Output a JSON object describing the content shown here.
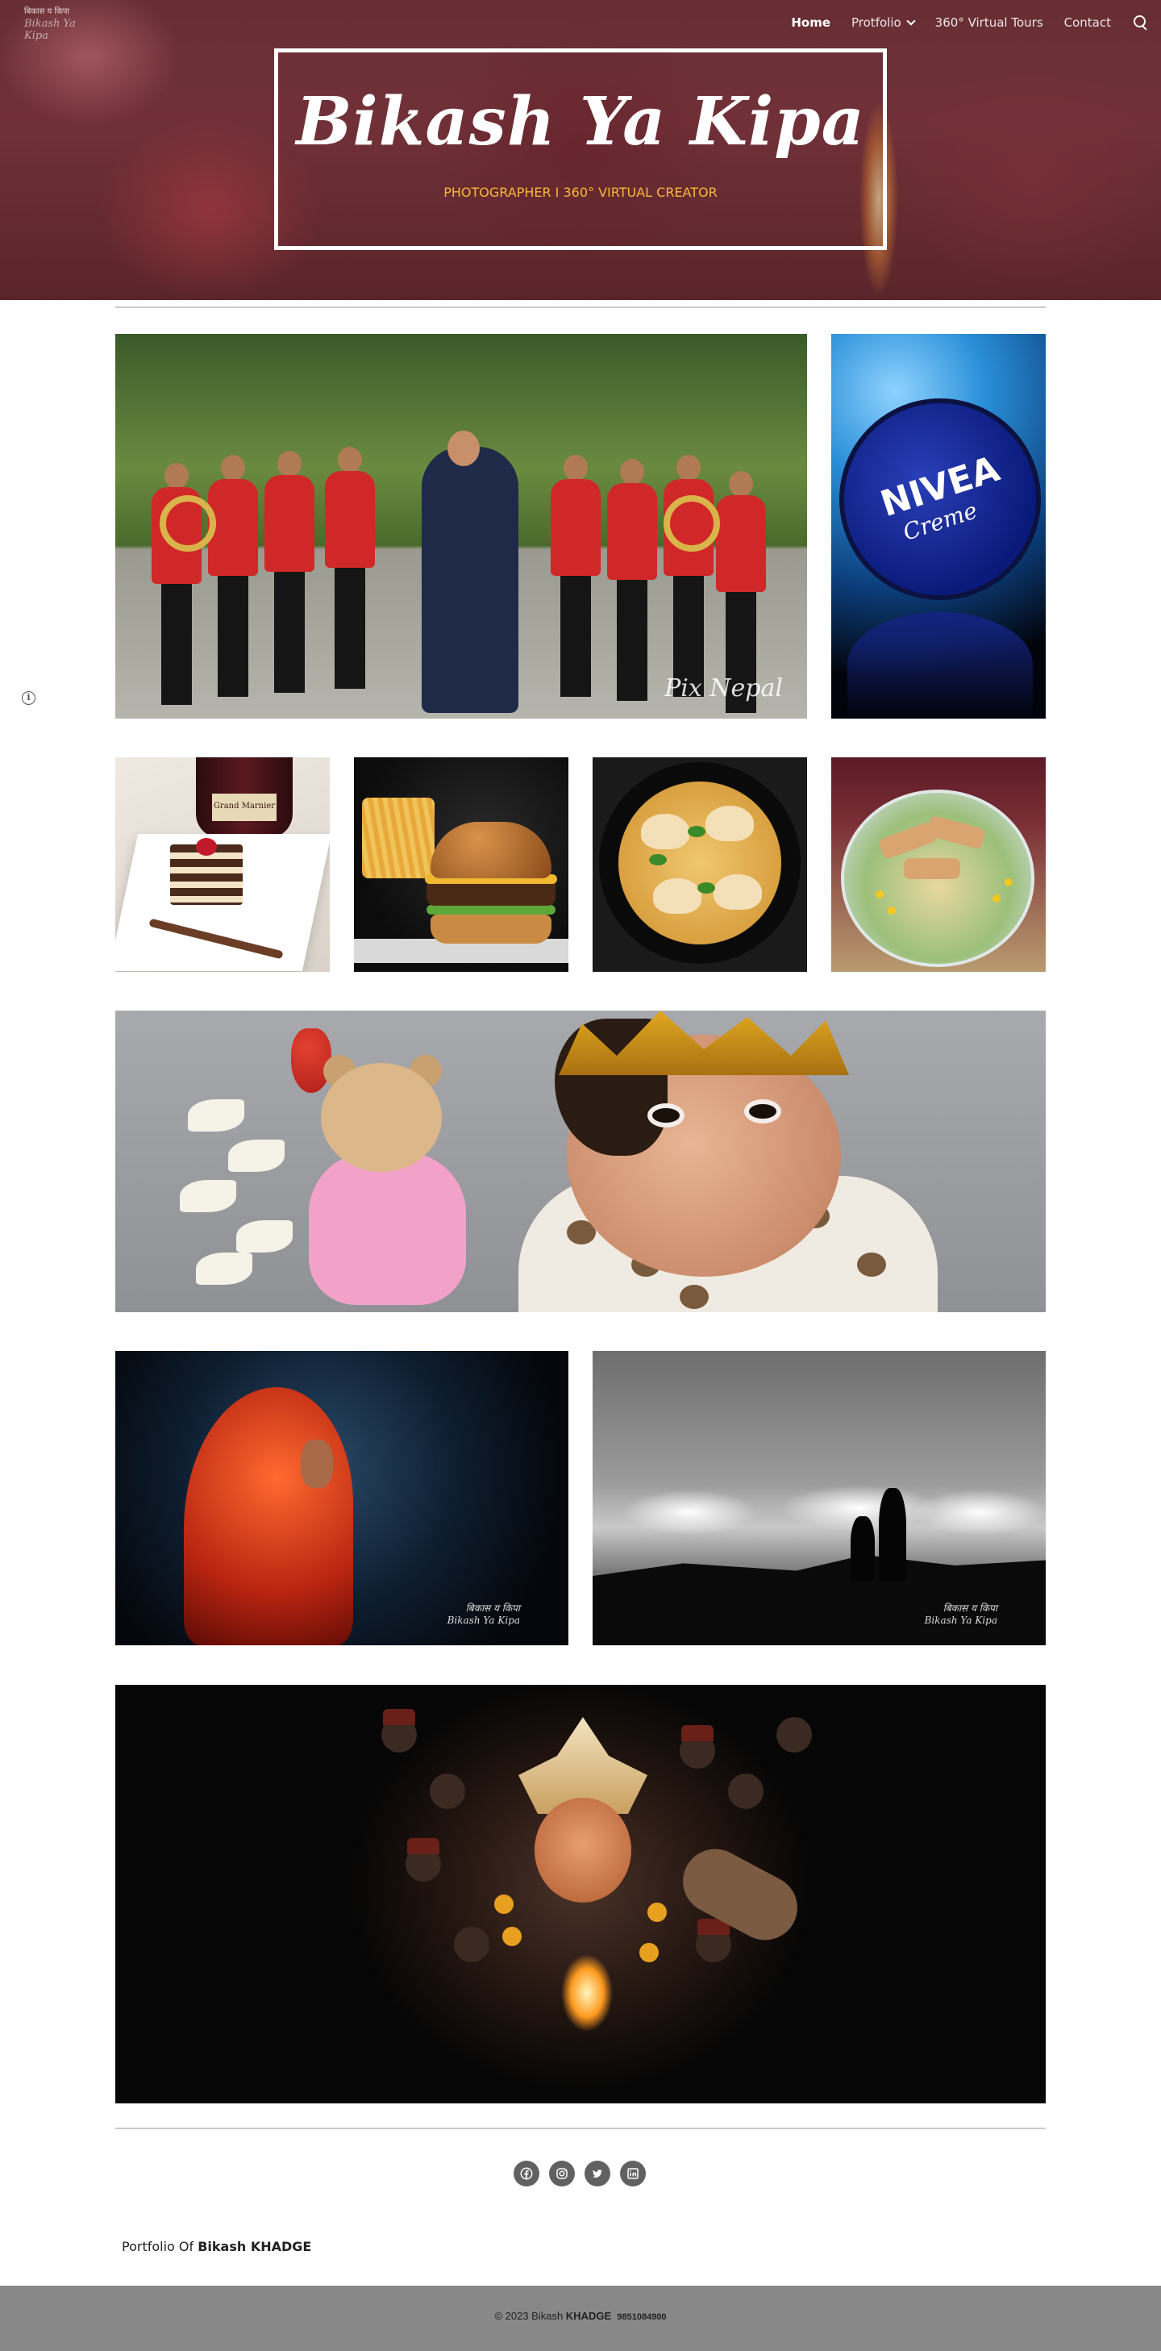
{
  "header": {
    "logo_line1": "बिकास य किपा",
    "logo_line2": "Bikash Ya Kipa",
    "title": "Bikash Ya Kipa",
    "subtitle": "PHOTOGRAPHER I 360° VIRTUAL CREATOR"
  },
  "nav": {
    "items": [
      {
        "label": "Home",
        "active": true
      },
      {
        "label": "Protfolio",
        "has_dropdown": true
      },
      {
        "label": "360° Virtual Tours"
      },
      {
        "label": "Contact"
      }
    ],
    "search_icon": "search-icon"
  },
  "gallery": {
    "band_watermark": "Pix Nepal",
    "nivea_brand": "NIVEA",
    "nivea_product": "Creme",
    "dessert_bottle_label": "Grand Marnier",
    "woman_watermark_line1": "बिकास य किपा",
    "woman_watermark_line2": "Bikash Ya Kipa",
    "mount_watermark_line1": "बिकास य किपा",
    "mount_watermark_line2": "Bikash Ya Kipa"
  },
  "social": {
    "icons": [
      "facebook-icon",
      "instagram-icon",
      "twitter-icon",
      "linkedin-icon"
    ]
  },
  "portfolio_line": {
    "prefix": "Portfolio Of ",
    "name": "Bikash KHADGE"
  },
  "footer": {
    "prefix": "© 2023 Bikash ",
    "surname": "KHADGE",
    "phone": "9851084900"
  },
  "colors": {
    "subtitle": "#f4b93a",
    "footer_bg": "#888888",
    "social_bg": "#616161",
    "rule": "#c9c9c9"
  }
}
